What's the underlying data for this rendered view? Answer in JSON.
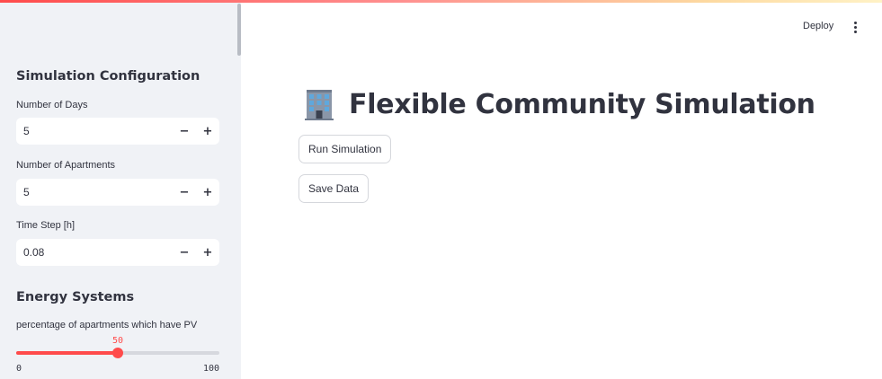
{
  "header": {
    "deploy_label": "Deploy",
    "menu_icon": "kebab-menu-icon"
  },
  "sidebar": {
    "sim_config_heading": "Simulation Configuration",
    "inputs": [
      {
        "label": "Number of Days",
        "value": "5"
      },
      {
        "label": "Number of Apartments",
        "value": "5"
      },
      {
        "label": "Time Step [h]",
        "value": "0.08"
      }
    ],
    "stepper": {
      "minus": "−",
      "plus": "+"
    },
    "energy_heading": "Energy Systems",
    "pv_slider": {
      "label": "percentage of apartments which have PV",
      "value": "50",
      "min": "0",
      "max": "100",
      "fraction": 0.5
    }
  },
  "main": {
    "title": "Flexible Community Simulation",
    "title_icon": "office-building-icon",
    "run_button": "Run Simulation",
    "save_button": "Save Data"
  },
  "colors": {
    "accent": "#ff4b4b",
    "sidebar_bg": "#f0f2f6",
    "text": "#31333f"
  }
}
